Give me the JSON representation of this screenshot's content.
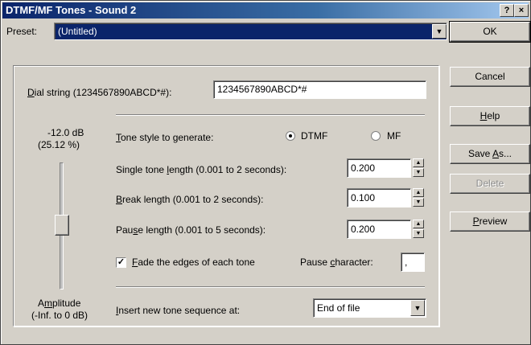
{
  "window": {
    "title": "DTMF/MF Tones - Sound 2",
    "help_glyph": "?",
    "close_glyph": "×"
  },
  "preset": {
    "label": "Preset:",
    "value": "(Untitled)"
  },
  "buttons": {
    "ok": "OK",
    "cancel": "Cancel",
    "help": "Help",
    "save_as": "Save As...",
    "delete": "Delete",
    "preview": "Preview"
  },
  "dial": {
    "label": "Dial string (1234567890ABCD*#):",
    "value": "1234567890ABCD*#"
  },
  "amplitude": {
    "db": "-12.0 dB",
    "percent": "(25.12 %)",
    "label1": "Amplitude",
    "label2": "(-Inf. to 0 dB)",
    "slider_level": 0.5
  },
  "tone_style": {
    "label": "Tone style to generate:",
    "options": [
      "DTMF",
      "MF"
    ],
    "selected": "DTMF"
  },
  "single_tone": {
    "label": "Single tone length (0.001 to 2 seconds):",
    "value": "0.200"
  },
  "break_len": {
    "label": "Break length (0.001 to 2 seconds):",
    "value": "0.100"
  },
  "pause_len": {
    "label": "Pause length (0.001 to 5 seconds):",
    "value": "0.200"
  },
  "fade": {
    "label": "Fade the edges of each tone",
    "checked": true
  },
  "pause_char": {
    "label": "Pause character:",
    "value": ","
  },
  "insert": {
    "label": "Insert new tone sequence at:",
    "value": "End of file"
  }
}
